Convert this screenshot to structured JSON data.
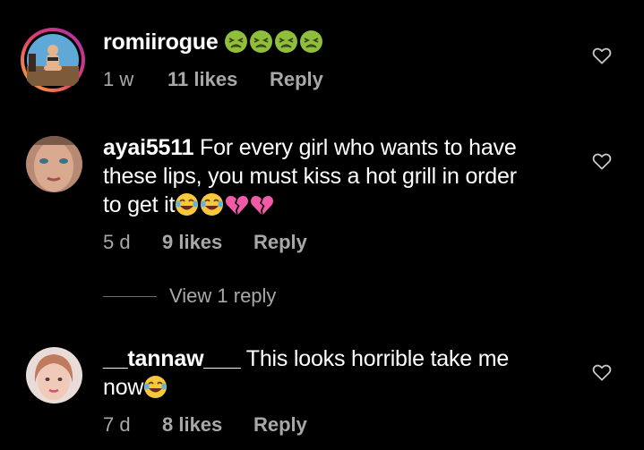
{
  "accent": "#ffffff",
  "muted": "#a8a8a8",
  "comments": [
    {
      "username": "romiirogue",
      "text": "",
      "emojis": [
        "nauseated-face-emoji",
        "nauseated-face-emoji",
        "nauseated-face-emoji",
        "nauseated-face-emoji"
      ],
      "time": "1 w",
      "likes": "11 likes",
      "reply": "Reply"
    },
    {
      "username": "ayai5511",
      "text_line1": "For every girl who wants to have",
      "text_line2": "these lips, you must kiss a hot grill in order",
      "text_line3": "to get it",
      "emojis": [
        "tears-of-joy-emoji",
        "tears-of-joy-emoji",
        "broken-heart-emoji",
        "broken-heart-emoji"
      ],
      "time": "5 d",
      "likes": "9 likes",
      "reply": "Reply"
    },
    {
      "username": "__tannaw___",
      "text_line1": "This looks horrible take me",
      "text_line2": "now",
      "emojis": [
        "tears-of-joy-emoji"
      ],
      "time": "7 d",
      "likes": "8 likes",
      "reply": "Reply"
    }
  ],
  "view_replies": "View 1 reply"
}
